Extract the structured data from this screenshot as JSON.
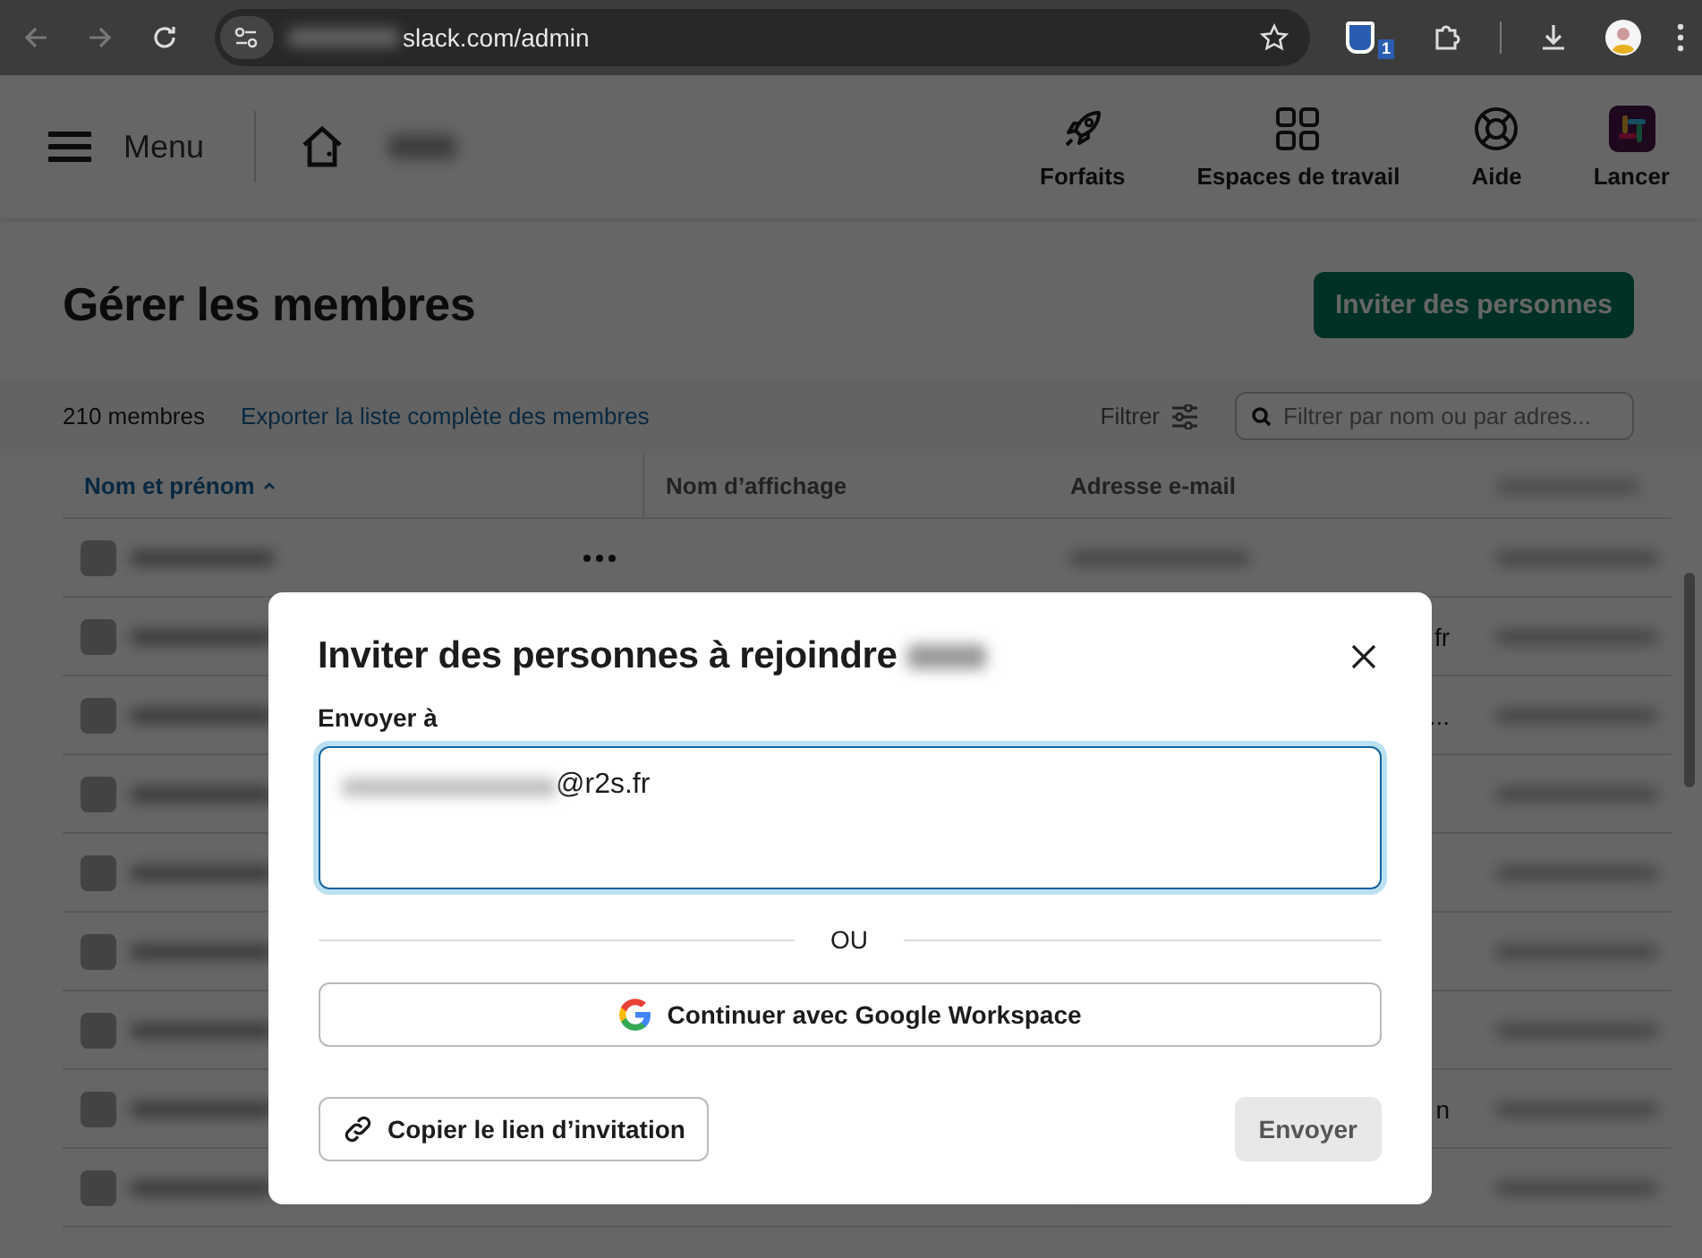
{
  "browser": {
    "url": "slack.com/admin",
    "extension_badge": "1"
  },
  "header": {
    "menu_label": "Menu",
    "nav": [
      {
        "label": "Forfaits",
        "kind": "rocket"
      },
      {
        "label": "Espaces de travail",
        "kind": "grid"
      },
      {
        "label": "Aide",
        "kind": "help"
      },
      {
        "label": "Lancer",
        "kind": "app"
      }
    ]
  },
  "page": {
    "title": "Gérer les membres",
    "invite_button": "Inviter des personnes",
    "member_count": "210 membres",
    "export_link": "Exporter la liste complète des membres",
    "filter_label": "Filtrer",
    "search": {
      "placeholder": "Filtrer par nom ou par adres..."
    }
  },
  "table": {
    "columns": [
      {
        "label": "Nom et prénom",
        "sorted": true
      },
      {
        "label": "Nom d’affichage",
        "sorted": false
      },
      {
        "label": "Adresse e-mail",
        "sorted": false
      }
    ],
    "rows": [
      {},
      {
        "email_tail": "fr"
      },
      {
        "email_tail": "..."
      },
      {},
      {},
      {},
      {},
      {
        "email_tail": "n"
      },
      {}
    ]
  },
  "dialog": {
    "title": "Inviter des personnes à rejoindre",
    "field_label": "Envoyer à",
    "field_value": "@r2s.fr",
    "divider_text": "OU",
    "google_button": "Continuer avec Google Workspace",
    "copy_link_button": "Copier le lien d’invitation",
    "send_button": {
      "label": "Envoyer",
      "disabled": true
    }
  }
}
